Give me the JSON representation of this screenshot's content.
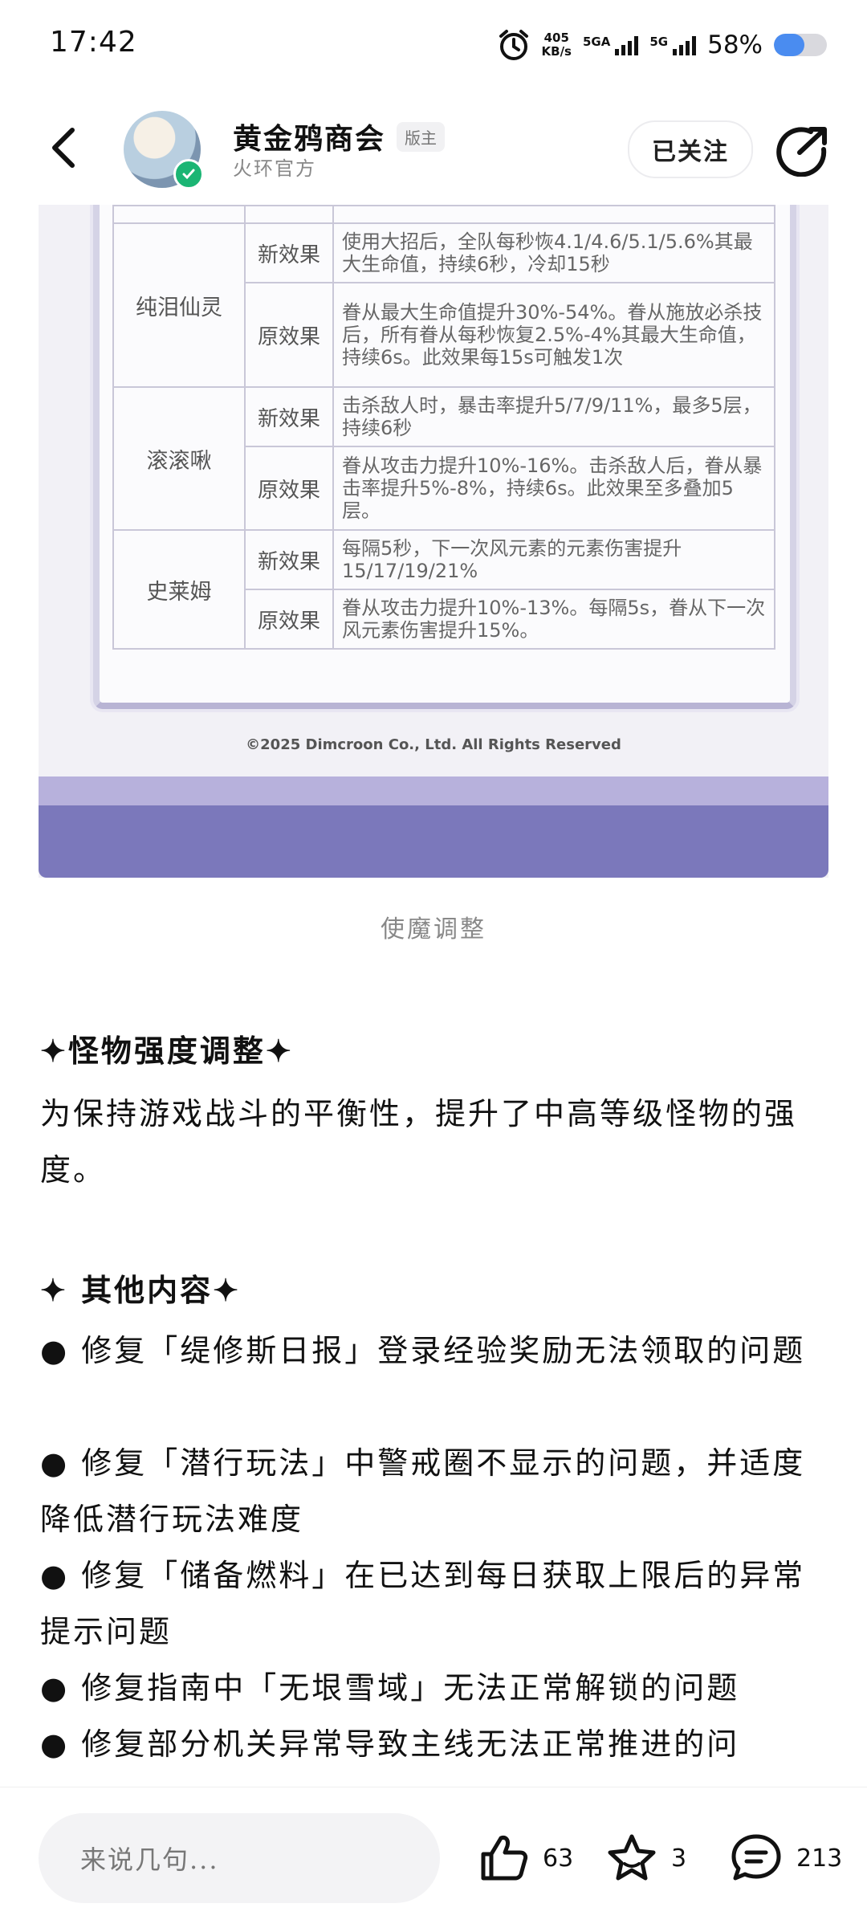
{
  "status_bar": {
    "time": "17:42",
    "net_speed_value": "405",
    "net_speed_unit": "KB/s",
    "sim1_label": "5GA",
    "sim2_label": "5G",
    "battery_percent": "58%",
    "battery_level": 0.58
  },
  "header": {
    "back_icon": "chevron-left-icon",
    "account_name": "黄金鸦商会",
    "badge": "版主",
    "account_subtitle": "火环官方",
    "follow_label": "已关注",
    "share_icon": "share-arrow-icon",
    "verified_color": "#1bb574"
  },
  "image": {
    "rows": [
      {
        "name": "纯泪仙灵",
        "new_label": "新效果",
        "new_text": "使用大招后，全队每秒恢4.1/4.6/5.1/5.6%其最大生命值，持续6秒，冷却15秒",
        "old_label": "原效果",
        "old_text": "眷从最大生命值提升30%-54%。眷从施放必杀技后，所有眷从每秒恢复2.5%-4%其最大生命值，持续6s。此效果每15s可触发1次"
      },
      {
        "name": "滚滚啾",
        "new_label": "新效果",
        "new_text": "击杀敌人时，暴击率提升5/7/9/11%，最多5层，持续6秒",
        "old_label": "原效果",
        "old_text": "眷从攻击力提升10%-16%。击杀敌人后，眷从暴击率提升5%-8%，持续6s。此效果至多叠加5层。"
      },
      {
        "name": "史莱姆",
        "new_label": "新效果",
        "new_text": "每隔5秒，下一次风元素的元素伤害提升15/17/19/21%",
        "old_label": "原效果",
        "old_text": "眷从攻击力提升10%-13%。每隔5s，眷从下一次风元素伤害提升15%。"
      }
    ],
    "copyright": "©2025 Dimcroon Co., Ltd. All Rights Reserved",
    "frame_color": "#7b78bb"
  },
  "caption": "使魔调整",
  "article": {
    "section1_title": "✦怪物强度调整✦",
    "section1_text": "为保持游戏战斗的平衡性，提升了中高等级怪物的强度。",
    "section2_title": "✦ 其他内容✦",
    "bullets": [
      "● 修复「缇修斯日报」登录经验奖励无法领取的问题",
      "● 修复「潜行玩法」中警戒圈不显示的问题，并适度降低潜行玩法难度",
      "● 修复「储备燃料」在已达到每日获取上限后的异常提示问题",
      "● 修复指南中「无垠雪域」无法正常解锁的问题",
      "● 修复部分机关异常导致主线无法正常推进的问"
    ]
  },
  "bottom_bar": {
    "comment_placeholder": "来说几句...",
    "like_icon": "thumbs-up-icon",
    "like_count": "63",
    "favorite_icon": "star-icon",
    "favorite_count": "3",
    "comment_icon": "comment-bubble-icon",
    "comment_count": "213"
  }
}
